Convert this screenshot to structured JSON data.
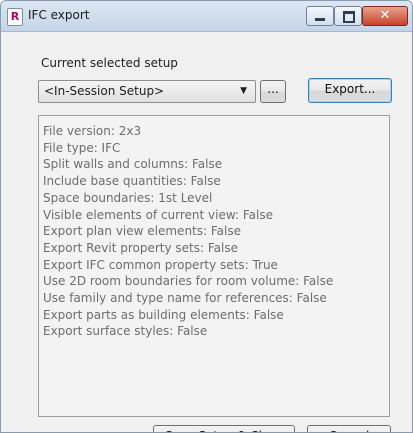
{
  "window": {
    "title": "IFC export",
    "icon_letter": "R"
  },
  "setup": {
    "label": "Current selected setup",
    "selected": "<In-Session Setup>",
    "more_label": "...",
    "export_label": "Export..."
  },
  "details": [
    "File version: 2x3",
    "File type: IFC",
    "Split walls and columns: False",
    "Include base quantities: False",
    "Space boundaries: 1st Level",
    "Visible elements of current view: False",
    "Export plan view elements: False",
    "Export Revit property sets: False",
    "Export IFC common property sets: True",
    "Use 2D room boundaries for room volume: False",
    "Use family and type name for references: False",
    "Export parts as building elements: False",
    "Export surface styles: False"
  ],
  "footer": {
    "save_close_label": "Save Setup & Close",
    "cancel_label": "Cancel"
  },
  "icons": {
    "app": "revit-app-icon",
    "minimize": "minimize-icon",
    "maximize": "maximize-icon",
    "close": "close-icon",
    "dropdown": "chevron-down-icon"
  }
}
